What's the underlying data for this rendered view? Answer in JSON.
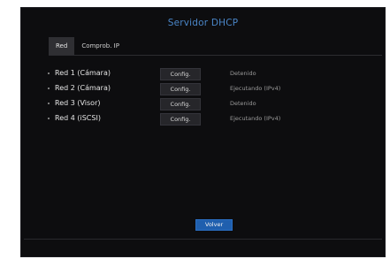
{
  "window": {
    "title": "Servidor DHCP"
  },
  "tabs": [
    {
      "label": "Red",
      "active": true
    },
    {
      "label": "Comprob. IP",
      "active": false
    }
  ],
  "networks": [
    {
      "name": "Red 1 (Cámara)",
      "button": "Config.",
      "status": "Detenido"
    },
    {
      "name": "Red 2 (Cámara)",
      "button": "Config.",
      "status": "Ejecutando (IPv4)"
    },
    {
      "name": "Red 3 (Visor)",
      "button": "Config.",
      "status": "Detenido"
    },
    {
      "name": "Red 4 (iSCSI)",
      "button": "Config.",
      "status": "Ejecutando (IPv4)"
    }
  ],
  "footer": {
    "back_label": "Volver"
  },
  "colors": {
    "background": "#0d0d0f",
    "title": "#4a86c8",
    "active_tab": "#2f2f33",
    "primary_button": "#1f5fae"
  }
}
